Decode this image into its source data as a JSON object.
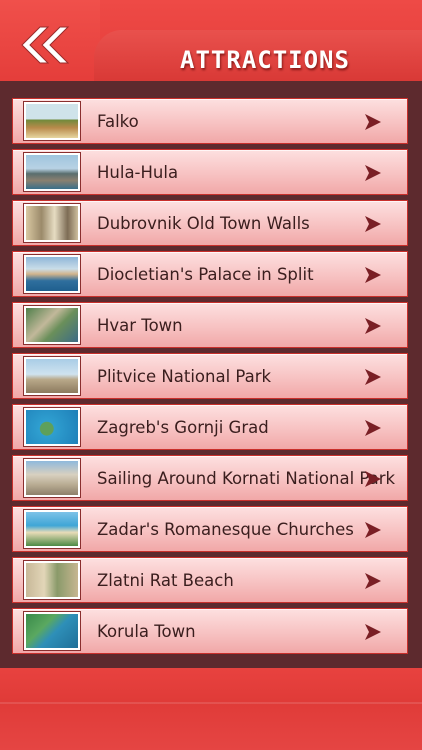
{
  "header": {
    "title": "ATTRACTIONS",
    "back_icon": "double-chevron-left-icon"
  },
  "colors": {
    "header_red": "#e8423f",
    "panel_maroon": "#5d2a2e",
    "row_pink": "#f7c2c2",
    "arrow": "#7a1f25"
  },
  "attractions": [
    {
      "label": "Falko",
      "thumbnail": "dancers-photo"
    },
    {
      "label": "Hula-Hula",
      "thumbnail": "coastal-town-photo"
    },
    {
      "label": "Dubrovnik Old Town Walls",
      "thumbnail": "old-town-photo"
    },
    {
      "label": "Diocletian's Palace in Split",
      "thumbnail": "harbor-photo"
    },
    {
      "label": "Hvar Town",
      "thumbnail": "aerial-town-photo"
    },
    {
      "label": "Plitvice National Park",
      "thumbnail": "church-photo"
    },
    {
      "label": "Zagreb's Gornji Grad",
      "thumbnail": "islands-photo"
    },
    {
      "label": "Sailing Around Kornati National Park",
      "thumbnail": "cathedral-photo"
    },
    {
      "label": "Zadar's Romanesque Churches",
      "thumbnail": "beach-photo"
    },
    {
      "label": "Zlatni Rat Beach",
      "thumbnail": "tower-street-photo"
    },
    {
      "label": "Korula Town",
      "thumbnail": "coastline-photo"
    }
  ]
}
